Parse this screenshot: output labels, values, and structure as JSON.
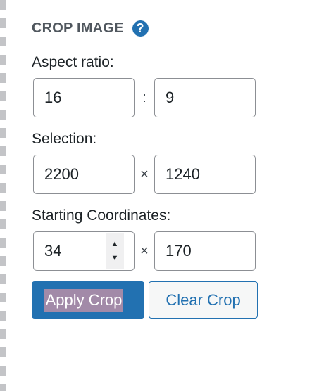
{
  "section": {
    "title": "CROP IMAGE",
    "help_icon": "?"
  },
  "aspect_ratio": {
    "label": "Aspect ratio:",
    "width": "16",
    "separator": ":",
    "height": "9"
  },
  "selection": {
    "label": "Selection:",
    "width": "2200",
    "separator": "×",
    "height": "1240"
  },
  "starting_coordinates": {
    "label": "Starting Coordinates:",
    "x": "34",
    "separator": "×",
    "y": "170",
    "stepper_up": "▲",
    "stepper_down": "▼"
  },
  "actions": {
    "apply_label": "Apply Crop",
    "clear_label": "Clear Crop"
  },
  "colors": {
    "accent": "#2271b1",
    "heading": "#50575e",
    "border": "#8c8f94",
    "text_highlight": "#a28aa8"
  }
}
